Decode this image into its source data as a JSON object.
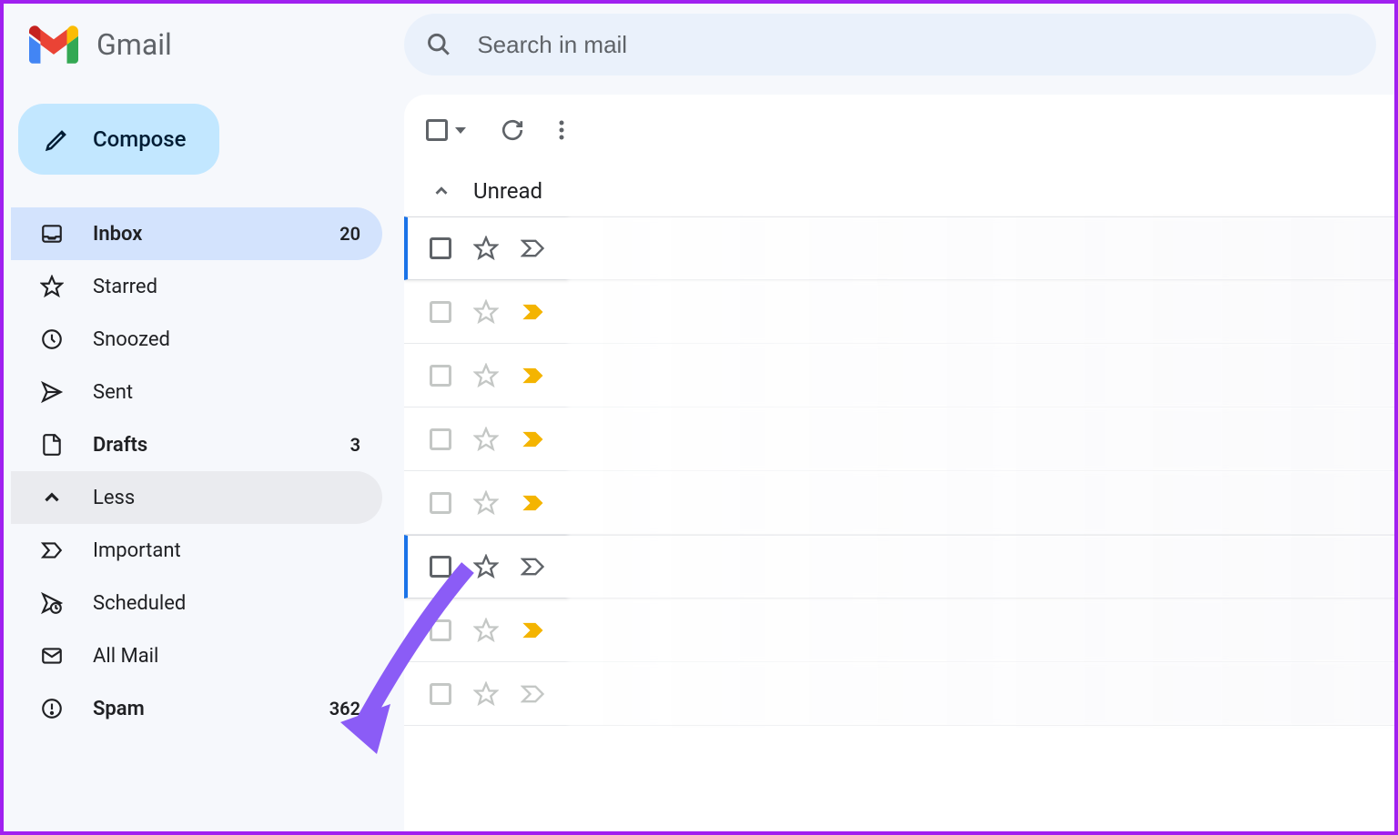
{
  "header": {
    "app_name": "Gmail",
    "search_placeholder": "Search in mail"
  },
  "compose": {
    "label": "Compose"
  },
  "sidebar": {
    "items": [
      {
        "label": "Inbox",
        "count": "20",
        "active": true,
        "bold": true
      },
      {
        "label": "Starred"
      },
      {
        "label": "Snoozed"
      },
      {
        "label": "Sent"
      },
      {
        "label": "Drafts",
        "count": "3",
        "bold": true
      },
      {
        "label": "Less",
        "hover": true
      },
      {
        "label": "Important"
      },
      {
        "label": "Scheduled"
      },
      {
        "label": "All Mail"
      },
      {
        "label": "Spam",
        "count": "362",
        "bold": true
      }
    ]
  },
  "section": {
    "title": "Unread"
  },
  "emails": [
    {
      "unread": true,
      "dim": false,
      "important_filled": false
    },
    {
      "dim": true,
      "important_filled": true,
      "important_color": "#f4b400"
    },
    {
      "dim": true,
      "important_filled": true,
      "important_color": "#f4b400"
    },
    {
      "dim": true,
      "important_filled": true,
      "important_color": "#f4b400"
    },
    {
      "dim": true,
      "important_filled": true,
      "important_color": "#f4b400"
    },
    {
      "unread": true,
      "dim": false,
      "important_filled": false
    },
    {
      "dim": true,
      "important_filled": true,
      "important_color": "#f4b400"
    },
    {
      "dim": true,
      "important_filled": false
    }
  ]
}
